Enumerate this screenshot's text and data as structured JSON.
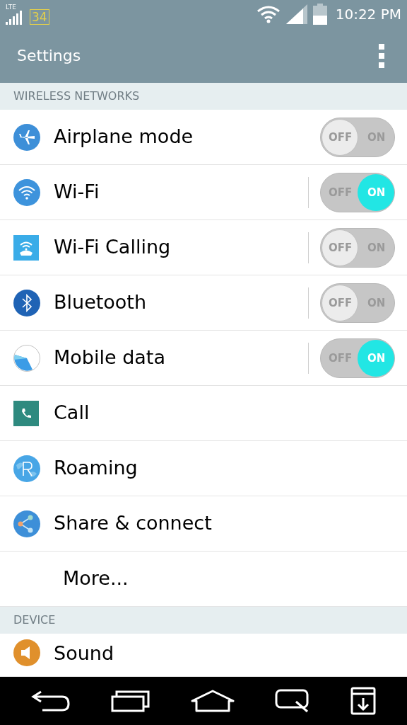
{
  "status_bar": {
    "network": "LTE",
    "battery_badge": "34",
    "time": "10:22 PM"
  },
  "app_bar": {
    "title": "Settings"
  },
  "sections": [
    {
      "title": "WIRELESS NETWORKS",
      "items": [
        {
          "label": "Airplane mode",
          "kind": "toggle",
          "on": false,
          "divider": false,
          "off_label": "OFF",
          "on_label": "ON"
        },
        {
          "label": "Wi-Fi",
          "kind": "toggle",
          "on": true,
          "divider": true,
          "off_label": "OFF",
          "on_label": "ON"
        },
        {
          "label": "Wi-Fi Calling",
          "kind": "toggle",
          "on": false,
          "divider": true,
          "off_label": "OFF",
          "on_label": "ON"
        },
        {
          "label": "Bluetooth",
          "kind": "toggle",
          "on": false,
          "divider": true,
          "off_label": "OFF",
          "on_label": "ON"
        },
        {
          "label": "Mobile data",
          "kind": "toggle",
          "on": true,
          "divider": true,
          "off_label": "OFF",
          "on_label": "ON"
        },
        {
          "label": "Call",
          "kind": "link"
        },
        {
          "label": "Roaming",
          "kind": "link"
        },
        {
          "label": "Share & connect",
          "kind": "link"
        },
        {
          "label": "More...",
          "kind": "plain"
        }
      ]
    },
    {
      "title": "DEVICE",
      "items": [
        {
          "label": "Sound",
          "kind": "link"
        }
      ]
    }
  ]
}
